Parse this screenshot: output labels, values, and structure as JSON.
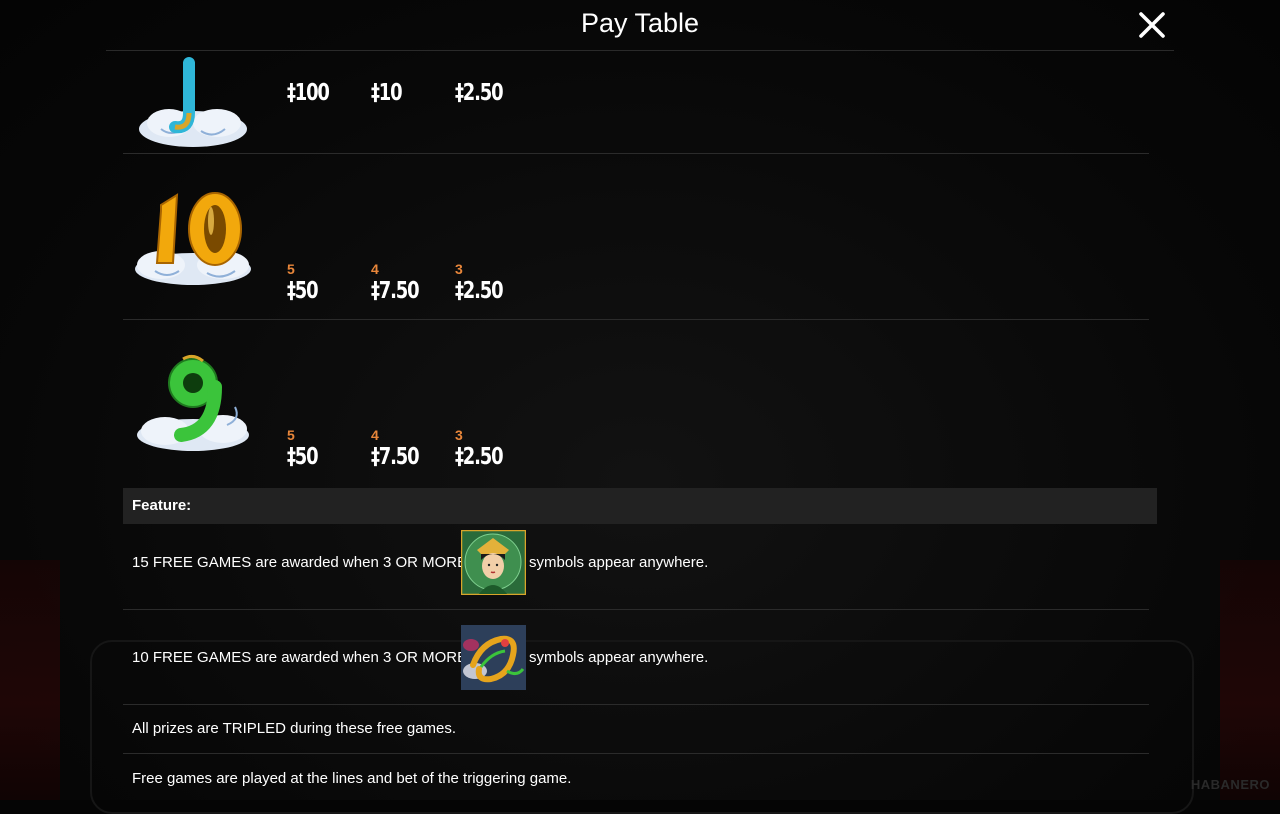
{
  "header": {
    "title": "Pay Table"
  },
  "brand": "HABANERO",
  "paytable": [
    {
      "symbol": "J",
      "pays": [
        {
          "count": "",
          "amount": "‡100"
        },
        {
          "count": "",
          "amount": "‡10"
        },
        {
          "count": "",
          "amount": "‡2.50"
        }
      ]
    },
    {
      "symbol": "10",
      "pays": [
        {
          "count": "5",
          "amount": "‡50"
        },
        {
          "count": "4",
          "amount": "‡7.50"
        },
        {
          "count": "3",
          "amount": "‡2.50"
        }
      ]
    },
    {
      "symbol": "9",
      "pays": [
        {
          "count": "5",
          "amount": "‡50"
        },
        {
          "count": "4",
          "amount": "‡7.50"
        },
        {
          "count": "3",
          "amount": "‡2.50"
        }
      ]
    }
  ],
  "feature": {
    "heading": "Feature:",
    "lines": [
      {
        "before": "15 FREE GAMES are awarded when 3 OR MORE",
        "after": "symbols appear anywhere."
      },
      {
        "before": "10 FREE GAMES are awarded when 3 OR MORE",
        "after": "symbols appear anywhere."
      },
      {
        "before": "All prizes are TRIPLED during these free games."
      },
      {
        "before": "Free games are played at the lines and bet of the triggering game."
      }
    ]
  },
  "colors": {
    "count": "#e8863a",
    "panel": "#000000",
    "feature_bar": "#222222"
  }
}
